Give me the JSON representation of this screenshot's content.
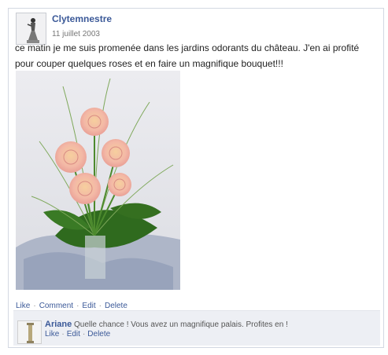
{
  "post": {
    "author": "Clytemnestre",
    "date": "11 juillet 2003",
    "text": "ce matin je me suis promenée dans les jardins odorants du château. J'en ai profité pour couper quelques roses et en faire un magnifique bouquet!!!",
    "actions": [
      "Like",
      "Comment",
      "Edit",
      "Delete"
    ]
  },
  "comment": {
    "author": "Ariane",
    "text": "Quelle chance ! Vous avez un magnifique palais. Profites en !",
    "actions": [
      "Like",
      "Edit",
      "Delete"
    ]
  },
  "colors": {
    "link": "#3b5998",
    "comment_bg": "#edeff4",
    "border": "#d3d8e2"
  },
  "icons": {
    "post_avatar": "statuette-avatar",
    "comment_avatar": "column-avatar",
    "photo": "rose-bouquet-photo"
  }
}
